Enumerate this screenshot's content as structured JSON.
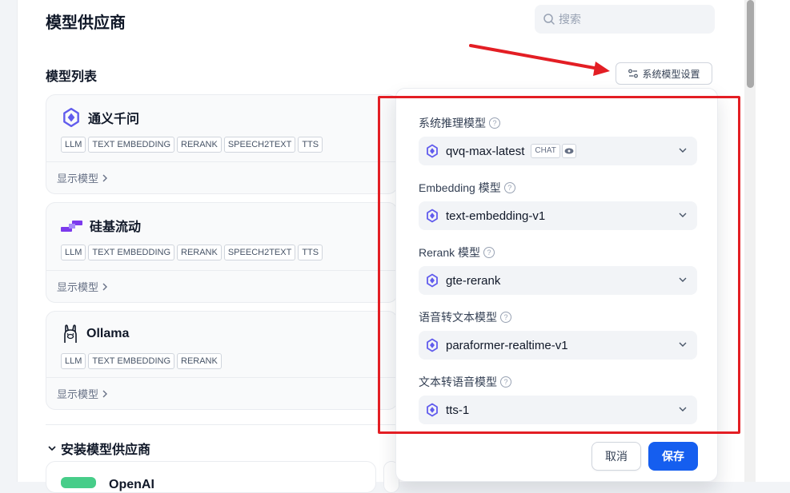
{
  "page": {
    "title": "模型供应商"
  },
  "search": {
    "placeholder": "搜索",
    "icon": "search-icon"
  },
  "model_list": {
    "title": "模型列表"
  },
  "system_settings_button": {
    "label": "系统模型设置",
    "icon": "settings-sliders-icon"
  },
  "providers": [
    {
      "name": "通义千问",
      "icon": "tongyi-logo",
      "tags": [
        "LLM",
        "TEXT EMBEDDING",
        "RERANK",
        "SPEECH2TEXT",
        "TTS"
      ],
      "show_models": "显示模型"
    },
    {
      "name": "硅基流动",
      "icon": "siliconflow-logo",
      "tags": [
        "LLM",
        "TEXT EMBEDDING",
        "RERANK",
        "SPEECH2TEXT",
        "TTS"
      ],
      "show_models": "显示模型"
    },
    {
      "name": "Ollama",
      "icon": "ollama-logo",
      "tags": [
        "LLM",
        "TEXT EMBEDDING",
        "RERANK"
      ],
      "show_models": "显示模型"
    }
  ],
  "install_section": {
    "title": "安装模型供应商",
    "first_peek": "OpenAI"
  },
  "system_model_panel": {
    "fields": [
      {
        "label": "系统推理模型",
        "value": "qvq-max-latest",
        "chip": "CHAT",
        "has_vision": true
      },
      {
        "label": "Embedding 模型",
        "value": "text-embedding-v1"
      },
      {
        "label": "Rerank 模型",
        "value": "gte-rerank"
      },
      {
        "label": "语音转文本模型",
        "value": "paraformer-realtime-v1"
      },
      {
        "label": "文本转语音模型",
        "value": "tts-1"
      }
    ],
    "cancel_label": "取消",
    "save_label": "保存"
  },
  "colors": {
    "accent": "#155eef",
    "annotation_red": "#e31e24",
    "tongyi_purple": "#615ced"
  }
}
